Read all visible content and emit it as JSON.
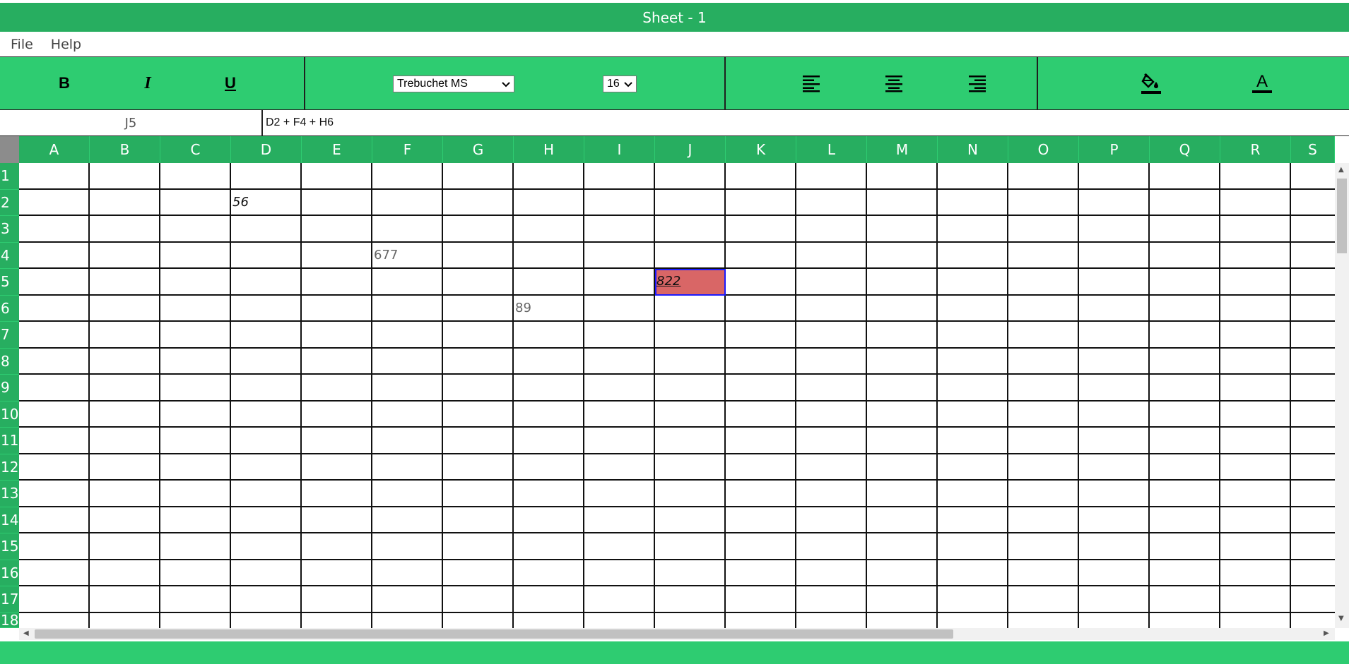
{
  "window": {
    "title": "Sheet - 1"
  },
  "menu": {
    "items": [
      "File",
      "Help"
    ]
  },
  "toolbar": {
    "bold_icon": "bold-icon",
    "italic_icon": "italic-icon",
    "underline_icon": "underline-icon",
    "font_family": "Trebuchet MS",
    "font_size": "16",
    "align_left_icon": "align-left-icon",
    "align_center_icon": "align-center-icon",
    "align_right_icon": "align-right-icon",
    "fill_color_icon": "fill-bucket-icon",
    "text_color_icon": "text-color-icon"
  },
  "formula_bar": {
    "cell_ref": "J5",
    "formula": "D2 + F4 + H6"
  },
  "grid": {
    "columns": [
      "A",
      "B",
      "C",
      "D",
      "E",
      "F",
      "G",
      "H",
      "I",
      "J",
      "K",
      "L",
      "M",
      "N",
      "O",
      "P",
      "Q",
      "R",
      "S"
    ],
    "rows": [
      "1",
      "2",
      "3",
      "4",
      "5",
      "6",
      "7",
      "8",
      "9",
      "10",
      "11",
      "12",
      "13",
      "14",
      "15",
      "16",
      "17",
      "18"
    ],
    "cells": [
      {
        "ref": "D2",
        "col": 3,
        "row": 1,
        "value": "56",
        "italic": true,
        "underline": false,
        "color": "#111111",
        "fill": null,
        "selected": false
      },
      {
        "ref": "F4",
        "col": 5,
        "row": 3,
        "value": "677",
        "italic": false,
        "underline": false,
        "color": "#666666",
        "fill": null,
        "selected": false
      },
      {
        "ref": "J5",
        "col": 9,
        "row": 4,
        "value": "822",
        "italic": true,
        "underline": true,
        "color": "#111111",
        "fill": "#d96666",
        "selected": true
      },
      {
        "ref": "H6",
        "col": 7,
        "row": 5,
        "value": "89",
        "italic": false,
        "underline": false,
        "color": "#666666",
        "fill": null,
        "selected": false
      }
    ]
  },
  "colors": {
    "title_bar": "#27ae60",
    "toolbar": "#2ecc71",
    "header": "#27ae60",
    "selection_border": "#1a1aff",
    "selected_fill": "#d96666"
  }
}
